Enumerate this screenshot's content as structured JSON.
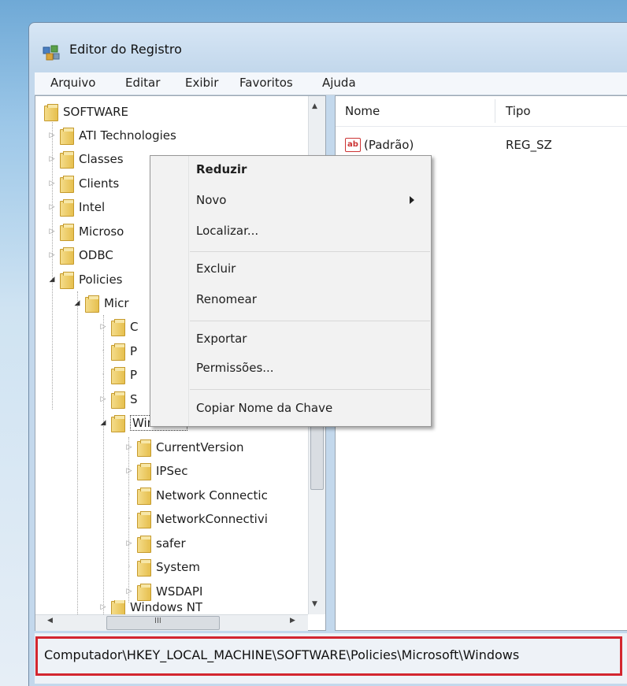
{
  "window": {
    "title": "Editor do Registro"
  },
  "menu": [
    "Arquivo",
    "Editar",
    "Exibir",
    "Favoritos",
    "Ajuda"
  ],
  "tree": {
    "root": "SOFTWARE",
    "items": [
      {
        "label": "ATI Technologies",
        "level": 1
      },
      {
        "label": "Classes",
        "level": 1
      },
      {
        "label": "Clients",
        "level": 1
      },
      {
        "label": "Intel",
        "level": 1
      },
      {
        "label": "Microso",
        "level": 1
      },
      {
        "label": "ODBC",
        "level": 1
      },
      {
        "label": "Policies",
        "level": 1
      },
      {
        "label": "Micr",
        "level": 2
      },
      {
        "label": "C",
        "level": 3
      },
      {
        "label": "P",
        "level": 3
      },
      {
        "label": "P",
        "level": 3
      },
      {
        "label": "S",
        "level": 3
      },
      {
        "label": "Windows",
        "level": 3
      },
      {
        "label": "CurrentVersion",
        "level": 4
      },
      {
        "label": "IPSec",
        "level": 4
      },
      {
        "label": "Network Connectic",
        "level": 4
      },
      {
        "label": "NetworkConnectivi",
        "level": 4
      },
      {
        "label": "safer",
        "level": 4
      },
      {
        "label": "System",
        "level": 4
      },
      {
        "label": "WSDAPI",
        "level": 4
      },
      {
        "label": "Windows NT",
        "level": 3
      }
    ],
    "scroll_hint": "III"
  },
  "list": {
    "columns": [
      "Nome",
      "Tipo"
    ],
    "rows": [
      {
        "name": "(Padrão)",
        "type": "REG_SZ",
        "icon": "ab"
      }
    ]
  },
  "context_menu": {
    "items": [
      "Reduzir",
      "Novo",
      "Localizar...",
      "Excluir",
      "Renomear",
      "Exportar",
      "Permissões...",
      "Copiar Nome da Chave"
    ]
  },
  "status": {
    "path": "Computador\\HKEY_LOCAL_MACHINE\\SOFTWARE\\Policies\\Microsoft\\Windows"
  },
  "colors": {
    "highlight_border": "#d3262f",
    "folder": "#e6bf4e"
  }
}
